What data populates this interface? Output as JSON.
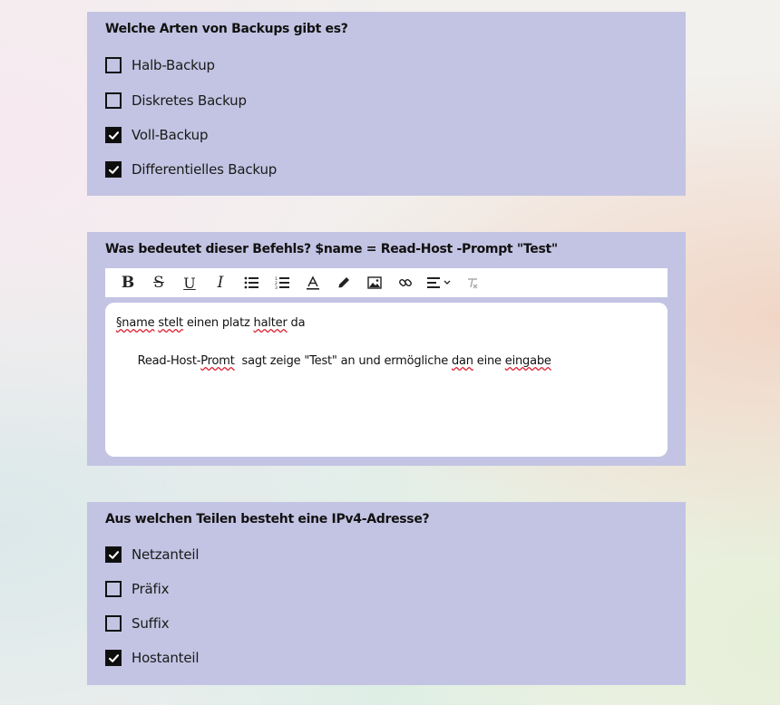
{
  "questions": [
    {
      "title": "Welche Arten von Backups gibt es?",
      "options": [
        {
          "label": "Halb-Backup",
          "checked": false
        },
        {
          "label": "Diskretes Backup",
          "checked": false
        },
        {
          "label": "Voll-Backup",
          "checked": true
        },
        {
          "label": "Differentielles Backup",
          "checked": true
        }
      ]
    },
    {
      "title": "Was bedeutet dieser Befehls? $name = Read-Host -Prompt \"Test\"",
      "toolbar": [
        "bold-icon",
        "strikethrough-icon",
        "underline-icon",
        "italic-icon",
        "bullet-list-icon",
        "numbered-list-icon",
        "text-color-icon",
        "highlight-pen-icon",
        "image-icon",
        "link-icon",
        "align-dropdown-icon",
        "clear-format-icon"
      ],
      "answer": {
        "line1_parts": [
          "§name",
          " ",
          "stelt",
          " einen platz ",
          "halter",
          " da"
        ],
        "line2_parts": [
          "Read-Host-",
          "Promt",
          "  sagt zeige \"Test\" an und ermögliche ",
          "dan",
          " eine ",
          "eingabe"
        ]
      }
    },
    {
      "title": "Aus welchen Teilen besteht eine IPv4-Adresse?",
      "options": [
        {
          "label": "Netzanteil",
          "checked": true
        },
        {
          "label": "Präfix",
          "checked": false
        },
        {
          "label": "Suffix",
          "checked": false
        },
        {
          "label": "Hostanteil",
          "checked": true
        }
      ]
    }
  ]
}
